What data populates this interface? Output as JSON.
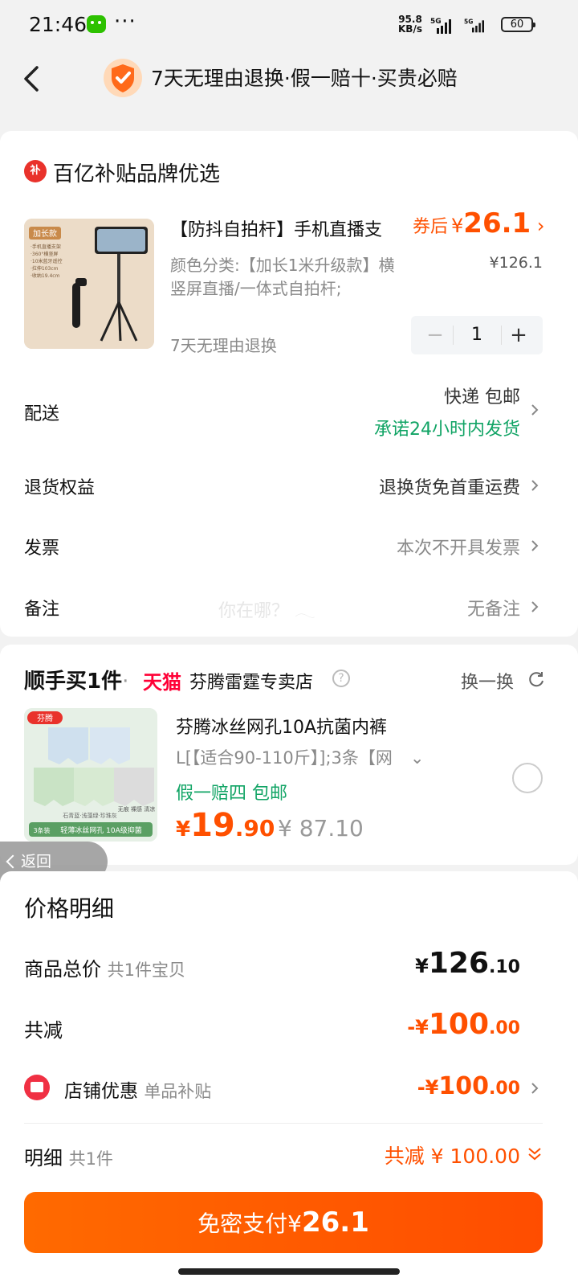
{
  "status_bar": {
    "time": "21:46",
    "net_speed_value": "95.8",
    "net_speed_unit": "KB/s",
    "sim1": "5G",
    "sim2": "5G",
    "battery": "60"
  },
  "header": {
    "title": "7天无理由退换·假一赔十·买贵必赔"
  },
  "order": {
    "brand_logo": "补",
    "brand_title": "百亿补贴品牌优选",
    "product": {
      "image_tag": "加长款",
      "image_notes": [
        "·手机直播支架",
        "·360°横竖屏",
        "·10米蓝牙遥控",
        "·拉伸103cm",
        "·收纳19.4cm"
      ],
      "title": "【防抖自拍杆】手机直播支",
      "variant": "颜色分类:【加长1米升级款】横竖屏直播/一体式自拍杆;",
      "return_policy": "7天无理由退换",
      "coupon_label": "券后",
      "coupon_currency": "¥",
      "coupon_price": "26.1",
      "original_price": "¥126.1",
      "quantity": "1"
    },
    "rows": {
      "delivery": {
        "label": "配送",
        "value": "快递 包邮",
        "promise": "承诺24小时内发货"
      },
      "returns": {
        "label": "退货权益",
        "value": "退换货免首重运费"
      },
      "invoice": {
        "label": "发票",
        "value": "本次不开具发票"
      },
      "note": {
        "label": "备注",
        "value": "无备注",
        "overlay_text": "你在哪？ 𓂃"
      }
    }
  },
  "addon": {
    "brand": "顺手买1件",
    "separator": "·",
    "platform": "天猫",
    "store": "芬腾雷霆专卖店",
    "info_icon": "?",
    "swap_label": "换一换",
    "product": {
      "image_brand": "芬腾",
      "image_count": "3条装",
      "image_caption": "轻薄冰丝网孔 10A级抑菌",
      "image_badges": "无痕 裸感 清凉",
      "image_colors": "石青蓝·浅藻绿·珍珠灰",
      "title": "芬腾冰丝网孔10A抗菌内裤",
      "sku": "L[【适合90-110斤】];3条【网",
      "tag": "假一赔四  包邮",
      "price_symbol": "¥",
      "price_int": "19",
      "price_dec": ".90",
      "original_price": "¥ 87.10"
    }
  },
  "float_back": {
    "label": "返回"
  },
  "price_detail": {
    "title": "价格明细",
    "subtotal": {
      "label": "商品总价",
      "sub": "共1件宝贝",
      "symbol": "¥",
      "int": "126",
      "dec": ".10"
    },
    "discount_total": {
      "label": "共减",
      "symbol": "-¥",
      "int": "100",
      "dec": ".00"
    },
    "shop_discount": {
      "label": "店铺优惠",
      "sub": "单品补贴",
      "symbol": "-¥",
      "int": "100",
      "dec": ".00"
    },
    "summary": {
      "label": "明细",
      "sub": "共1件",
      "value": "共减 ¥ 100.00"
    }
  },
  "pay_button": {
    "label": "免密支付",
    "currency": "¥",
    "amount": "26.1"
  },
  "colors": {
    "accent": "#ff5000",
    "green": "#11a465",
    "tmall": "#ff0036",
    "badge_red": "#e9322b"
  },
  "icons": [
    "back-arrow-icon",
    "shield-check-icon",
    "wechat-icon",
    "signal-icon",
    "battery-icon",
    "chevron-right-icon",
    "info-icon",
    "refresh-icon",
    "radio-icon",
    "shop-icon",
    "double-chevron-down-icon"
  ]
}
